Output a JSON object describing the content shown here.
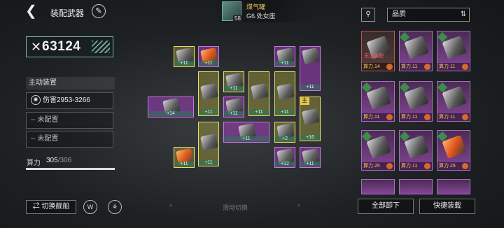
{
  "header": {
    "back_icon": "back-arrow-icon",
    "title": "装配武器",
    "edit_icon": "feather-icon",
    "ship_level": "58",
    "ship_name": "煤气罐",
    "ship_subtitle": "G6.处女座"
  },
  "power": {
    "value": "63124",
    "icon": "crossed-swords-icon"
  },
  "active_gear": {
    "label": "主动装置",
    "slots": [
      {
        "text": "伤害2953-3266",
        "icon": "claw-icon"
      },
      {
        "text": "-- 未配置"
      },
      {
        "text": "-- 未配置"
      }
    ]
  },
  "cost": {
    "label": "算力",
    "current": "305",
    "max": "/306"
  },
  "grid": {
    "main_badge": "主",
    "plus_labels": [
      "+11",
      "+11",
      "+14",
      "+11",
      "+11",
      "+11",
      "+11",
      "+11",
      "+11",
      "+16",
      "+11",
      "+11",
      "+11",
      "+11",
      "+2",
      "+12",
      "+11",
      "+11",
      "+13"
    ]
  },
  "bottom": {
    "switch_ship": "切换舰船",
    "swipe_hint": "滑动切换",
    "arrow_left": "‹",
    "arrow_right": "›"
  },
  "right_panel": {
    "sort_label": "品质",
    "sort_icon": "sort-toggle-icon",
    "filter_icon": "filter-icon",
    "items": [
      {
        "foot": "算力.14",
        "warn": "无法装配",
        "locked": true
      },
      {
        "foot": "算力.11"
      },
      {
        "foot": "算力.11"
      },
      {
        "foot": "算力.11"
      },
      {
        "foot": "算力.11"
      },
      {
        "foot": "算力.11"
      },
      {
        "foot": "算力.25"
      },
      {
        "foot": "算力.11"
      },
      {
        "foot": "算力.25"
      }
    ],
    "unequip_all": "全部卸下",
    "quick_equip": "快捷装载"
  },
  "colors": {
    "accent": "#e6c54a",
    "rare": "#a04cbe",
    "frame_yellow": "#e3df6a"
  }
}
